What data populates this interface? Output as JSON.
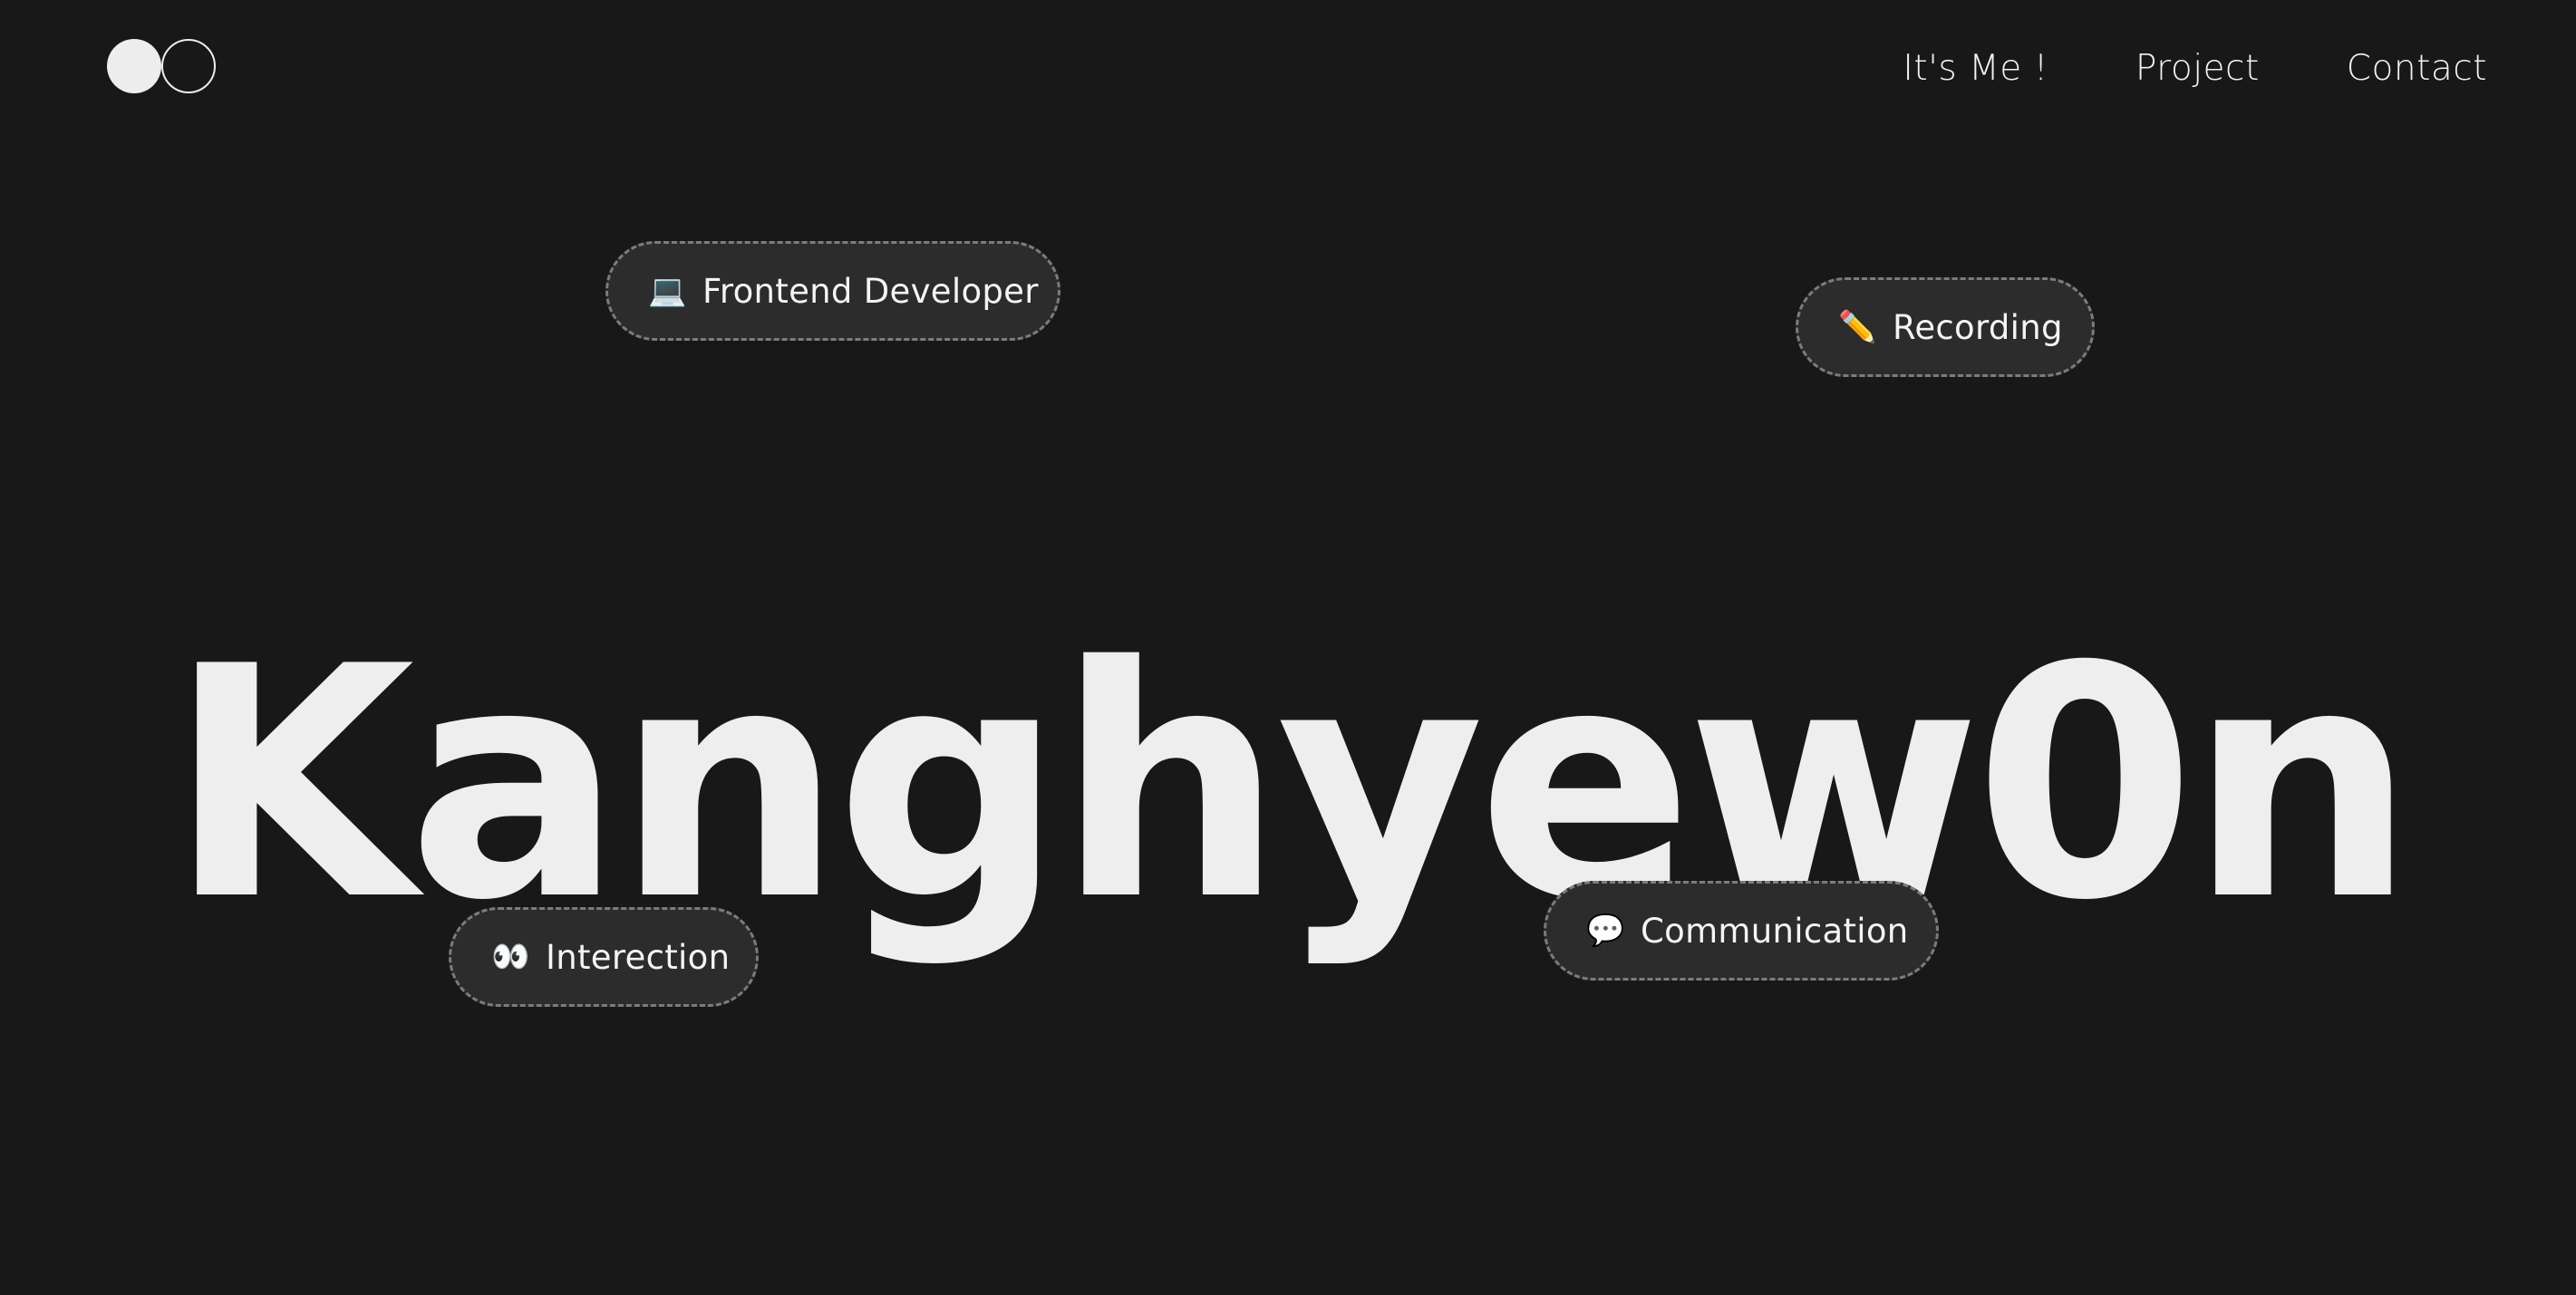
{
  "logo": {
    "icon": "two-circles-logo-icon"
  },
  "nav": {
    "items": [
      {
        "label": "It's Me !"
      },
      {
        "label": "Project"
      },
      {
        "label": "Contact"
      }
    ]
  },
  "hero": {
    "name": "Kanghyew0n"
  },
  "chips": {
    "frontend": {
      "emoji": "💻",
      "icon": "laptop-icon",
      "label": "Frontend Developer"
    },
    "recording": {
      "emoji": "✏️",
      "icon": "pencil-icon",
      "label": "Recording"
    },
    "interection": {
      "emoji": "👀",
      "icon": "eyes-icon",
      "label": "Interection"
    },
    "communication": {
      "emoji": "💬",
      "icon": "speech-bubble-icon",
      "label": "Communication"
    }
  },
  "colors": {
    "background": "#181818",
    "text": "#eeeeee",
    "chip_background": "#2c2c2c",
    "chip_border": "#7c7c7c"
  }
}
